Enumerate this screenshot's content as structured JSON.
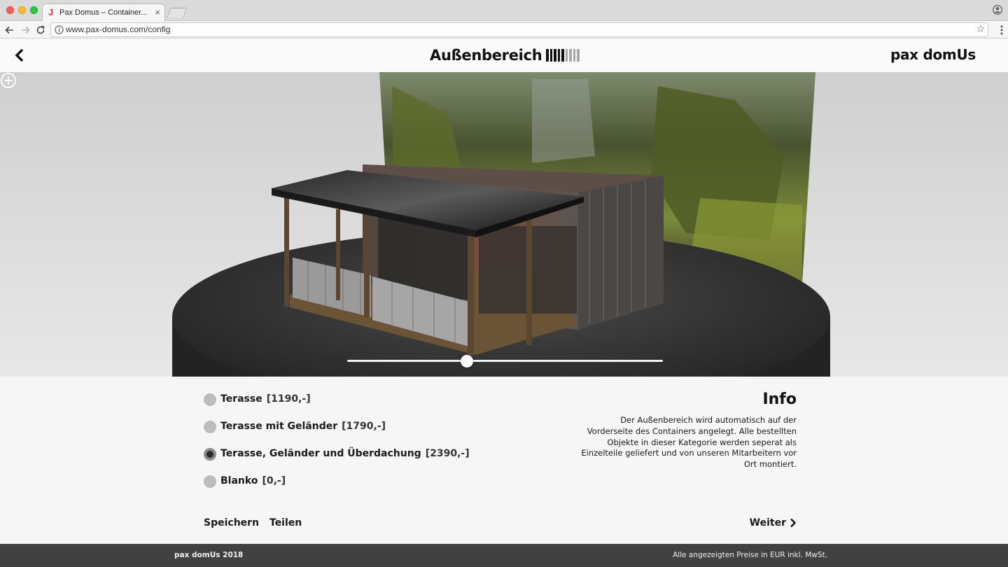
{
  "browser": {
    "tab_title": "Pax Domus – Container...",
    "tab_close": "×",
    "url": "www.pax-domus.com/config",
    "favicon": "J",
    "star": "☆"
  },
  "header": {
    "title": "Außenbereich",
    "brand": "pax domUs",
    "progress": {
      "completed": 5,
      "total": 9
    },
    "colors": {
      "done": "#111111",
      "todo": "#a9a9a9"
    }
  },
  "viewer": {
    "slider_value": 0.38
  },
  "options": [
    {
      "label": "Terasse",
      "price": "[1190,-]",
      "selected": false
    },
    {
      "label": "Terasse mit Geländer",
      "price": "[1790,-]",
      "selected": false
    },
    {
      "label": "Terasse, Geländer und Überdachung",
      "price": "[2390,-]",
      "selected": true
    },
    {
      "label": "Blanko",
      "price": "[0,-]",
      "selected": false
    }
  ],
  "info": {
    "title": "Info",
    "text": "Der Außenbereich wird automatisch auf der Vorderseite des Containers angelegt. Alle bestellten Objekte in dieser Kategorie werden seperat als Einzelteile geliefert und von unseren Mitarbeitern vor Ort montiert."
  },
  "actions": {
    "save": "Speichern",
    "share": "Teilen",
    "next": "Weiter"
  },
  "footer": {
    "left": "pax domUs 2018",
    "right": "Alle angezeigten Preise in EUR inkl. MwSt."
  }
}
